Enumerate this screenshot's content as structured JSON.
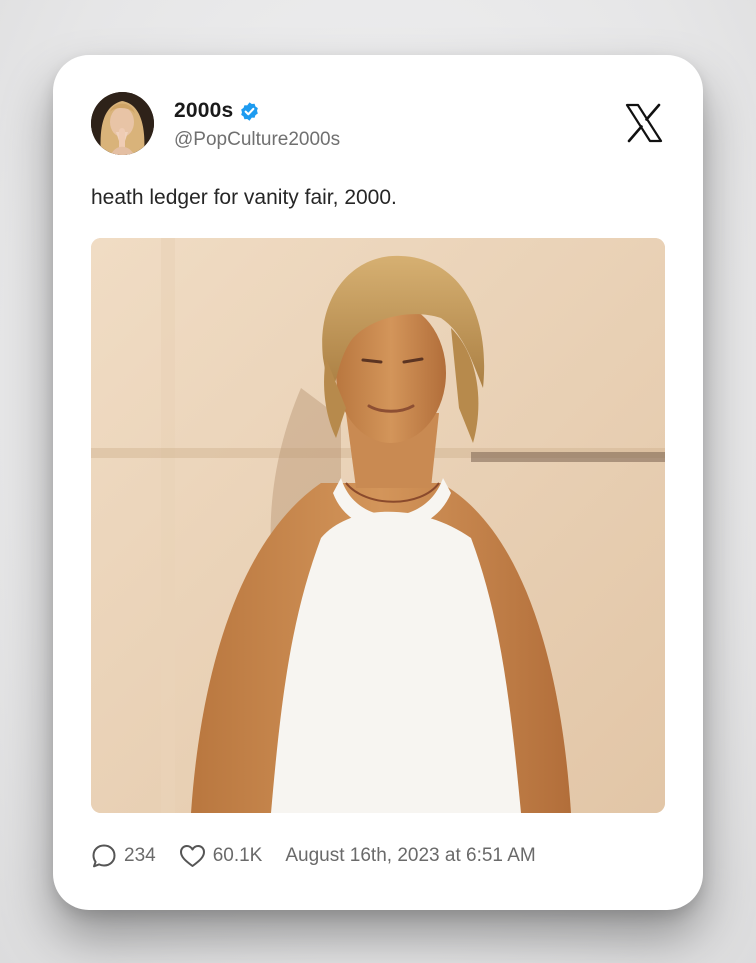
{
  "tweet": {
    "display_name": "2000s",
    "handle": "@PopCulture2000s",
    "verified": true,
    "text": "heath ledger for vanity fair, 2000.",
    "replies": "234",
    "likes": "60.1K",
    "timestamp": "August 16th, 2023 at 6:51 AM"
  },
  "icons": {
    "verified": "verified-badge-icon",
    "brand": "x-logo-icon",
    "reply": "speech-bubble-icon",
    "like": "heart-icon"
  },
  "colors": {
    "verified_blue": "#1d9bf0",
    "card_background": "#ffffff",
    "muted_text": "#6a6a6a"
  }
}
